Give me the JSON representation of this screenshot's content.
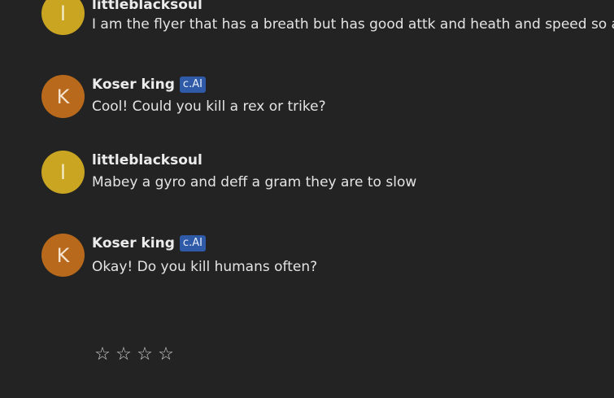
{
  "messages": [
    {
      "initial": "l",
      "name": "littleblacksoul",
      "badge": "",
      "text": "I am the flyer that has a breath but has good attk and heath and speed so a fe",
      "avatar_color": "#c9a522",
      "initial_color": "#f6efd0"
    },
    {
      "initial": "K",
      "name": "Koser king",
      "badge": "c.AI",
      "text": "Cool! Could you kill a rex or trike?",
      "avatar_color": "#b8691c",
      "initial_color": "#f5e2cf"
    },
    {
      "initial": "l",
      "name": "littleblacksoul",
      "badge": "",
      "text": "Mabey a gyro and deff a gram they are to slow",
      "avatar_color": "#c9a522",
      "initial_color": "#f6efd0"
    },
    {
      "initial": "K",
      "name": "Koser king",
      "badge": "c.AI",
      "text": "Okay! Do you kill humans often?",
      "avatar_color": "#b8691c",
      "initial_color": "#f5e2cf"
    }
  ],
  "rating": {
    "stars": [
      "☆",
      "☆",
      "☆",
      "☆"
    ],
    "value": 0
  },
  "colors": {
    "background": "#232323",
    "badge": "#2e5aa8"
  }
}
